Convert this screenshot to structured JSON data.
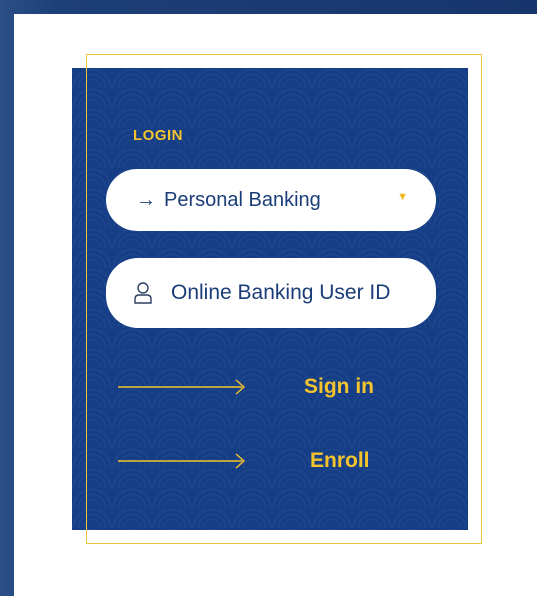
{
  "login": {
    "label": "LOGIN",
    "account_type": {
      "selected": "Personal Banking",
      "arrow_icon": "right-arrow-icon",
      "caret_icon": "caret-down-icon"
    },
    "user_id_field": {
      "placeholder": "Online Banking User ID",
      "icon": "user-icon"
    },
    "actions": {
      "sign_in": "Sign in",
      "enroll": "Enroll"
    }
  },
  "colors": {
    "panel_blue": "#153e86",
    "accent_gold": "#f5c42c",
    "text_navy": "#1a3d78"
  }
}
